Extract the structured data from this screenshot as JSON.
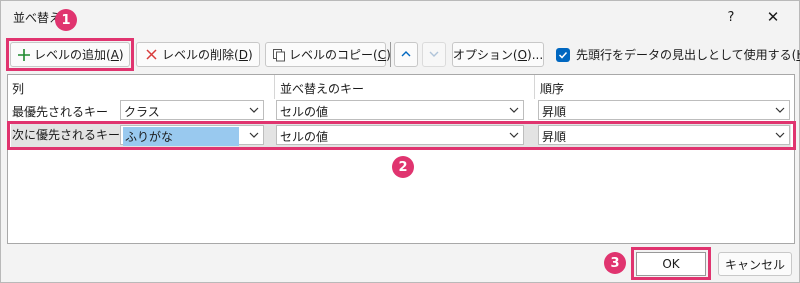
{
  "window": {
    "title": "並べ替え",
    "help_label": "?",
    "close_label": "✕"
  },
  "toolbar": {
    "add_level": {
      "label": "レベルの追加(",
      "key": "A",
      "suffix": ")"
    },
    "delete_level": {
      "label": "レベルの削除(",
      "key": "D",
      "suffix": ")"
    },
    "copy_level": {
      "label": "レベルのコピー(",
      "key": "C",
      "suffix": ")"
    },
    "options": {
      "label": "オプション(",
      "key": "O",
      "suffix": ")..."
    },
    "header_checkbox": {
      "label": "先頭行をデータの見出しとして使用する(",
      "key": "H",
      "suffix": ")",
      "checked": true
    }
  },
  "grid": {
    "headers": {
      "column": "列",
      "sort_on": "並べ替えのキー",
      "order": "順序"
    },
    "rows": [
      {
        "label": "最優先されるキー",
        "column": "クラス",
        "sort_on": "セルの値",
        "order": "昇順"
      },
      {
        "label": "次に優先されるキー",
        "column": "ふりがな",
        "sort_on": "セルの値",
        "order": "昇順"
      }
    ]
  },
  "buttons": {
    "ok": "OK",
    "cancel": "キャンセル"
  },
  "annotations": {
    "badge1": "1",
    "badge2": "2",
    "badge3": "3",
    "color": "#e0346f"
  },
  "colors": {
    "accent": "#0067c0",
    "highlight": "#e0346f",
    "selection": "#99c9ef"
  }
}
